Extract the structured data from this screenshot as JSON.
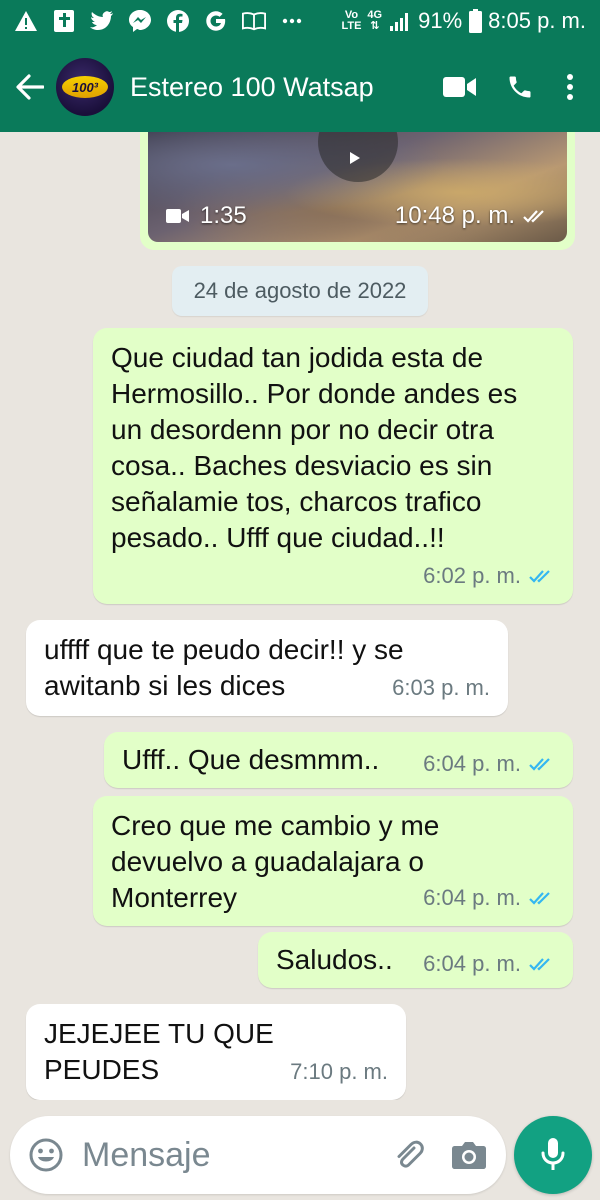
{
  "status_bar": {
    "network_label_top": "Vo",
    "network_label_bottom": "LTE",
    "signal_label": "4G",
    "battery": "91%",
    "time": "8:05 p. m."
  },
  "header": {
    "avatar_text": "100³",
    "title": "Estereo 100 Watsap"
  },
  "video_message": {
    "duration": "1:35",
    "time": "10:48 p. m."
  },
  "date_separator": "24 de agosto de 2022",
  "messages": [
    {
      "direction": "out",
      "text": "Que ciudad tan jodida esta de Hermosillo.. Por donde andes es un desordenn por no decir otra cosa.. Baches desviacio es sin señalamie tos, charcos trafico pesado.. Ufff que ciudad..!!",
      "time": "6:02 p. m."
    },
    {
      "direction": "in",
      "text": "uffff que te peudo decir!! y se awitanb si les dices",
      "time": "6:03 p. m."
    },
    {
      "direction": "out",
      "text": "Ufff.. Que desmmm..",
      "time": "6:04 p. m."
    },
    {
      "direction": "out",
      "text": "Creo que me cambio y me devuelvo a guadalajara o Monterrey",
      "time": "6:04 p. m."
    },
    {
      "direction": "out",
      "text": "Saludos..",
      "time": "6:04 p. m."
    },
    {
      "direction": "in",
      "text": "JEJEJEE TU QUE PEUDES",
      "time": "7:10 p. m."
    }
  ],
  "composer": {
    "placeholder": "Mensaje"
  },
  "colors": {
    "header_green": "#0a7a5a",
    "outgoing_bubble": "#e2ffc8",
    "incoming_bubble": "#ffffff",
    "read_ticks": "#34b7f1",
    "mic_button": "#12a182",
    "chat_background": "#e9e5df"
  },
  "icons": {
    "status": [
      "warning-icon",
      "bible-app-icon",
      "twitter-icon",
      "messenger-icon",
      "facebook-icon",
      "google-icon",
      "book-icon",
      "more-dots-icon",
      "signal-icon",
      "battery-icon"
    ],
    "header": [
      "back-arrow-icon",
      "video-call-icon",
      "phone-icon",
      "more-vert-icon"
    ],
    "composer": [
      "emoji-icon",
      "attach-icon",
      "camera-icon",
      "mic-icon"
    ]
  }
}
